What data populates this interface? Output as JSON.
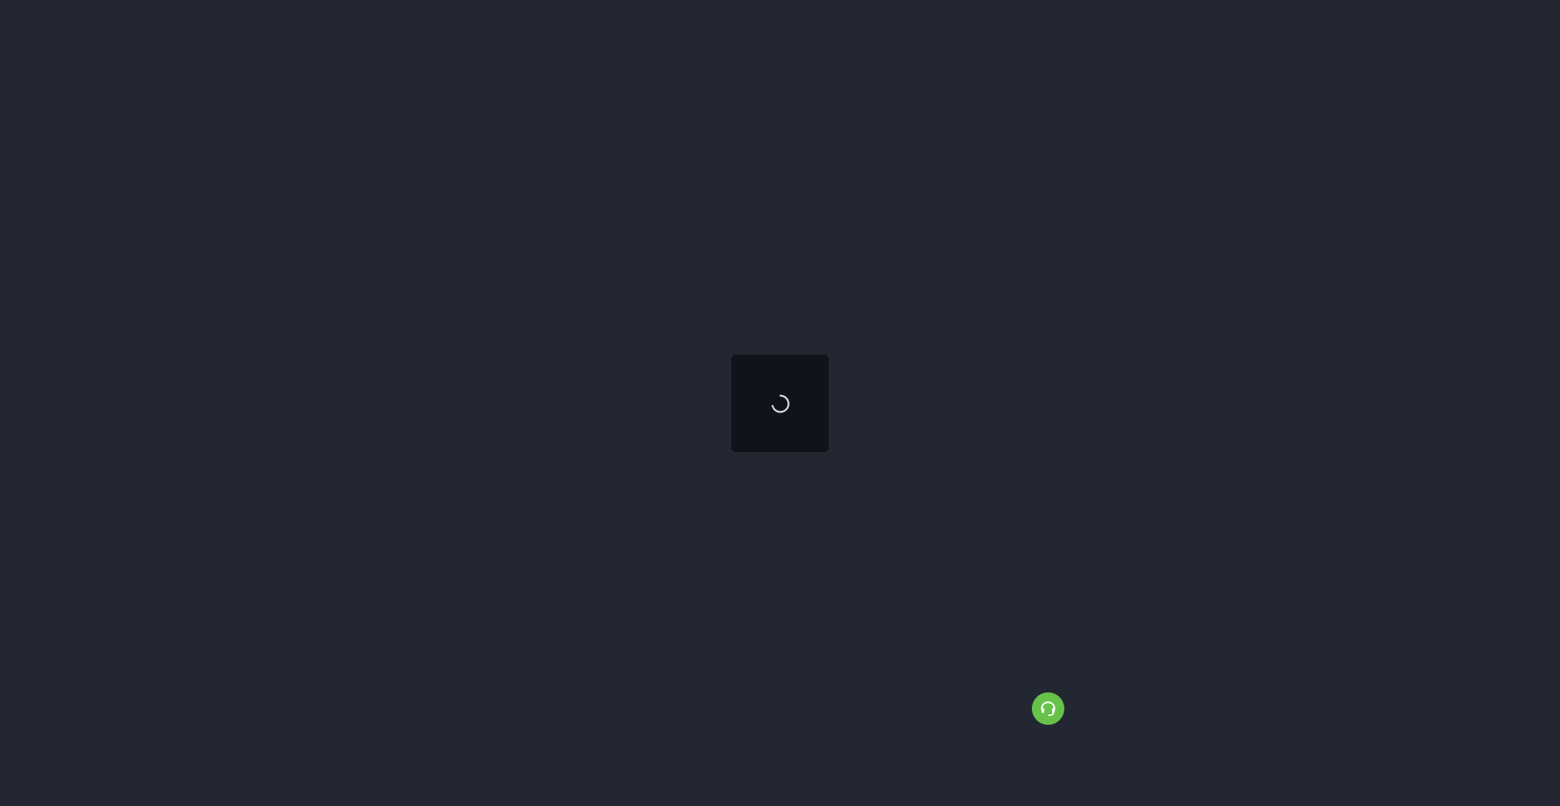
{
  "page": {
    "state": "loading",
    "background_color": "#232732"
  },
  "loader": {
    "icon": "loading-spinner-icon",
    "panel_color": "#10131a",
    "spinner_color": "#d9dde6"
  },
  "support_button": {
    "icon": "headset-icon",
    "background_color": "#67c24a",
    "icon_color": "#ffffff"
  }
}
